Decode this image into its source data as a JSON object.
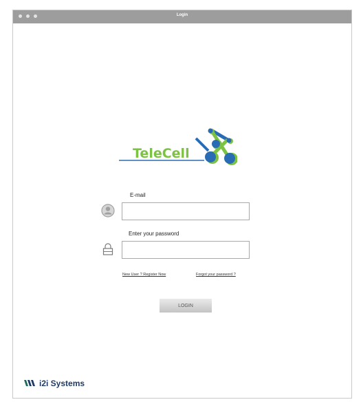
{
  "window": {
    "title": "Login"
  },
  "brand": {
    "name": "TeleCell"
  },
  "form": {
    "email_label": "E-mail",
    "email_value": "",
    "password_label": "Enter your password",
    "password_value": "",
    "register_link": "New User ? Register Now",
    "forgot_link": "Forgot your password ?",
    "login_button": "LOGIN"
  },
  "footer": {
    "company": "i2i Systems"
  },
  "icons": {
    "user": "user-avatar-icon",
    "lock": "lock-icon",
    "company": "i2i-logo-icon"
  },
  "colors": {
    "titlebar": "#9d9d9d",
    "brand_green": "#7cc243",
    "brand_blue": "#2a6cb3",
    "footer_blue": "#1f3b66"
  }
}
